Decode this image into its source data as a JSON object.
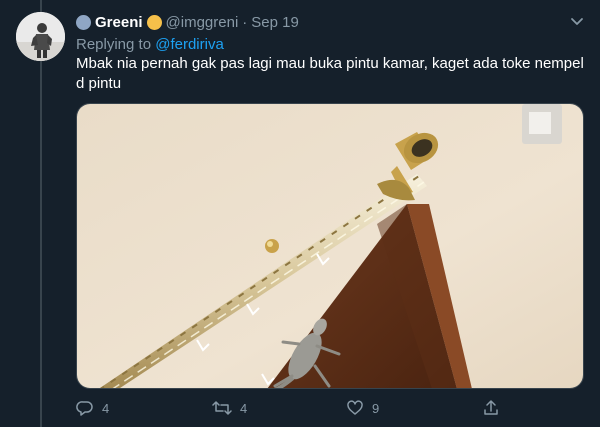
{
  "tweet": {
    "display_name": "Greeni",
    "handle": "@imggreni",
    "separator": "·",
    "date": "Sep 19",
    "replying_prefix": "Replying to",
    "replying_to": "@ferdiriva",
    "text": "Mbak nia pernah gak pas lagi mau buka pintu kamar, kaget ada toke nempel d pintu"
  },
  "actions": {
    "reply_count": "4",
    "retweet_count": "4",
    "like_count": "9"
  },
  "icons": {
    "reply": "reply-icon",
    "retweet": "retweet-icon",
    "like": "heart-icon",
    "share": "share-icon",
    "more": "chevron-down-icon"
  },
  "colors": {
    "background": "#15202b",
    "text": "#ffffff",
    "muted": "#8899a6",
    "link": "#1da1f2",
    "border": "#38444d"
  }
}
